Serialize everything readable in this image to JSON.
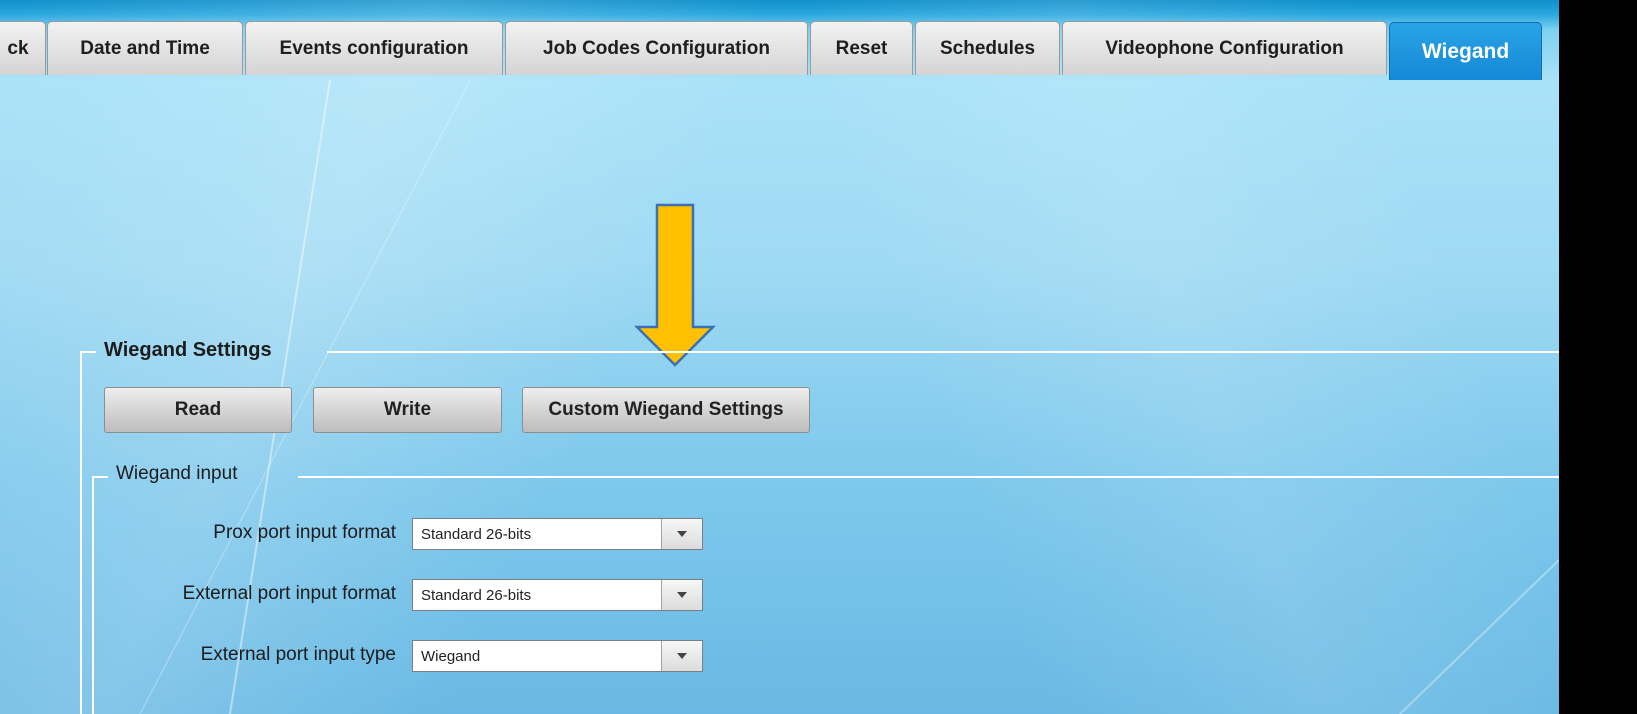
{
  "tabs": [
    {
      "label": "ck",
      "active": false
    },
    {
      "label": "Date and Time",
      "active": false
    },
    {
      "label": "Events configuration",
      "active": false
    },
    {
      "label": "Job Codes Configuration",
      "active": false
    },
    {
      "label": "Reset",
      "active": false
    },
    {
      "label": "Schedules",
      "active": false
    },
    {
      "label": "Videophone Configuration",
      "active": false
    },
    {
      "label": "Wiegand",
      "active": true
    }
  ],
  "settings": {
    "title": "Wiegand Settings",
    "read_label": "Read",
    "write_label": "Write",
    "custom_label": "Custom Wiegand Settings"
  },
  "input_group": {
    "title": "Wiegand input",
    "fields": [
      {
        "label": "Prox port input format",
        "value": "Standard 26-bits"
      },
      {
        "label": "External port input format",
        "value": "Standard 26-bits"
      },
      {
        "label": "External port input type",
        "value": "Wiegand"
      }
    ]
  },
  "annotation": {
    "arrow_color": "#ffc000",
    "arrow_outline": "#3c6fb4",
    "icon": "down-arrow-icon"
  },
  "colors": {
    "active_tab": "#1589d6",
    "background": "#a9e2f8"
  }
}
